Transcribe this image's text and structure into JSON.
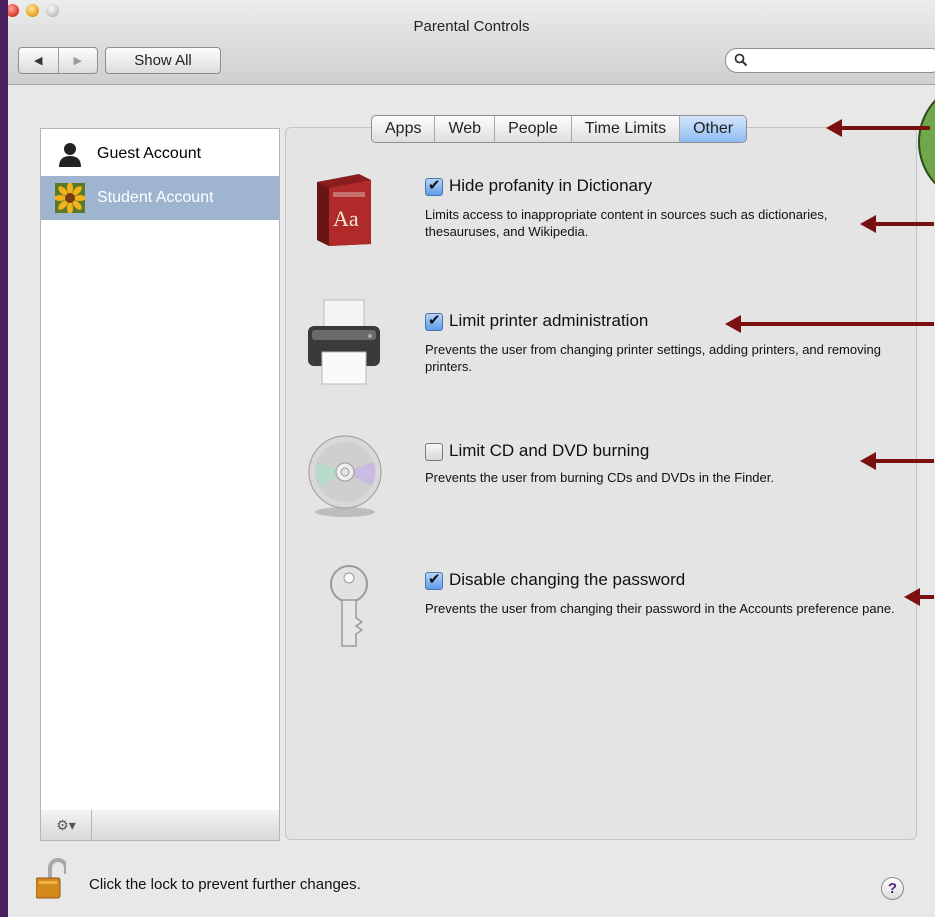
{
  "window": {
    "title": "Parental Controls"
  },
  "toolbar": {
    "back_icon": "◀",
    "forward_icon": "▶",
    "show_all_label": "Show All",
    "search_placeholder": ""
  },
  "sidebar": {
    "accounts": [
      {
        "label": "Guest Account",
        "icon": "person-silhouette-icon",
        "selected": false
      },
      {
        "label": "Student Account",
        "icon": "flower-avatar-icon",
        "selected": true
      }
    ],
    "gear_label": "⚙▾"
  },
  "tabs": [
    {
      "label": "Apps",
      "selected": false
    },
    {
      "label": "Web",
      "selected": false
    },
    {
      "label": "People",
      "selected": false
    },
    {
      "label": "Time Limits",
      "selected": false
    },
    {
      "label": "Other",
      "selected": true
    }
  ],
  "options": [
    {
      "label": "Hide profanity in Dictionary",
      "checked": true,
      "description": "Limits access to inappropriate content in sources such as dictionaries, thesauruses, and Wikipedia.",
      "icon": "dictionary-book-icon"
    },
    {
      "label": "Limit printer administration",
      "checked": true,
      "description": "Prevents the user from changing printer settings, adding printers, and removing printers.",
      "icon": "printer-icon"
    },
    {
      "label": "Limit CD and DVD burning",
      "checked": false,
      "description": "Prevents the user from burning CDs and DVDs in the Finder.",
      "icon": "disc-icon"
    },
    {
      "label": "Disable changing the password",
      "checked": true,
      "description": "Prevents the user from changing their password in the Accounts preference pane.",
      "icon": "key-icon"
    }
  ],
  "footer": {
    "lock_text": "Click the lock to prevent further changes.",
    "help_label": "?"
  },
  "colors": {
    "accent": "#8fbcf1",
    "annotation_arrow": "#7a1010",
    "annotation_circle": "#6fa84a",
    "selection": "#9fb4cf"
  }
}
